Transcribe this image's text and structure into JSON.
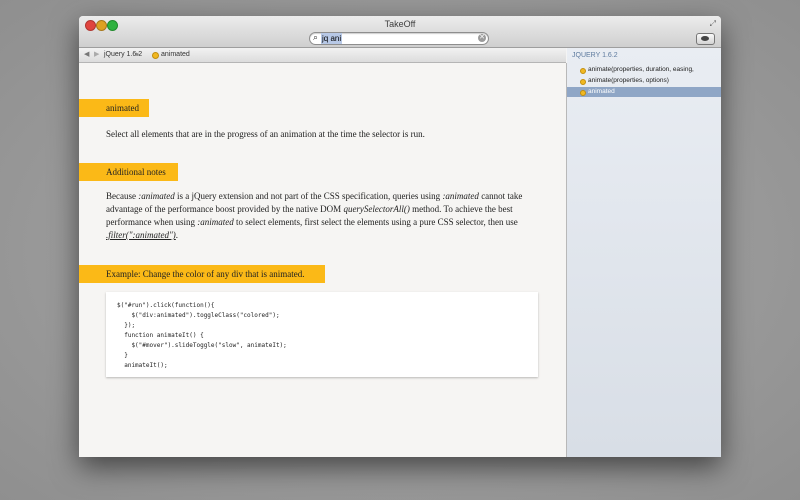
{
  "window": {
    "title": "TakeOff"
  },
  "search": {
    "value": "jq ani"
  },
  "nav": {
    "crumbs": [
      "jQuery 1.6.2",
      "animated"
    ]
  },
  "doc": {
    "heading": "animated",
    "summary": "Select all elements that are in the progress of an animation at the time the selector is run.",
    "notes_heading": "Additional notes",
    "notes": {
      "t1": "Because ",
      "e1": ":animated",
      "t2": " is a jQuery extension and not part of the CSS specification, queries using ",
      "e2": ":animated",
      "t3": " cannot take advantage of the performance boost provided by the native DOM ",
      "e3": "querySelectorAll()",
      "t4": " method. To achieve the best performance when using ",
      "e4": ":animated",
      "t5": " to select elements, first select the elements using a pure CSS selector, then use ",
      "e5": ".filter(\":animated\")",
      "t6": "."
    },
    "example_heading": "Example: Change the color of any div that is animated.",
    "code": "$(\"#run\").click(function(){\n    $(\"div:animated\").toggleClass(\"colored\");\n  });\n  function animateIt() {\n    $(\"#mover\").slideToggle(\"slow\", animateIt);\n  }\n  animateIt();"
  },
  "sidebar": {
    "header": "JQUERY 1.6.2",
    "items": [
      "animate(properties, duration, easing,",
      "animate(properties, options)",
      "animated"
    ]
  }
}
